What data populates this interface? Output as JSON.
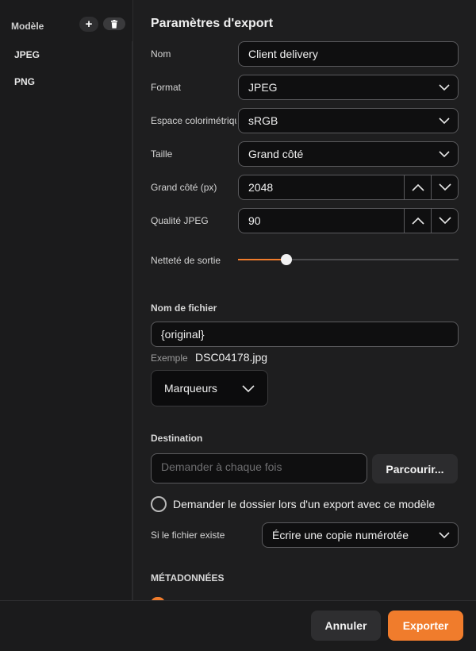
{
  "sidebar": {
    "header": "Modèle",
    "add_label": "+",
    "items": [
      {
        "label": "JPEG"
      },
      {
        "label": "PNG"
      }
    ]
  },
  "panel": {
    "title": "Paramètres d'export",
    "name": {
      "label": "Nom",
      "value": "Client delivery"
    },
    "format": {
      "label": "Format",
      "value": "JPEG"
    },
    "colorspace": {
      "label": "Espace colorimétrique",
      "value": "sRGB"
    },
    "size": {
      "label": "Taille",
      "value": "Grand côté"
    },
    "long_edge": {
      "label": "Grand côté (px)",
      "value": "2048"
    },
    "quality": {
      "label": "Qualité JPEG",
      "value": "90"
    },
    "sharpening": {
      "label": "Netteté de sortie",
      "level": 0.22
    }
  },
  "filename": {
    "section": "Nom de fichier",
    "value": "{original}",
    "example_label": "Exemple",
    "example_value": "DSC04178.jpg",
    "markers_label": "Marqueurs"
  },
  "destination": {
    "section": "Destination",
    "placeholder": "Demander à chaque fois",
    "browse_label": "Parcourir...",
    "ask_folder_label": "Demander le dossier lors d'un export avec ce modèle",
    "if_exists_label": "Si le fichier existe",
    "if_exists_value": "Écrire une copie numérotée"
  },
  "metadata": {
    "section": "MÉTADONNÉES"
  },
  "footer": {
    "cancel_label": "Annuler",
    "export_label": "Exporter"
  },
  "colors": {
    "accent": "#f07c2c",
    "background": "#1e1e1f",
    "field": "#0f0f10"
  }
}
